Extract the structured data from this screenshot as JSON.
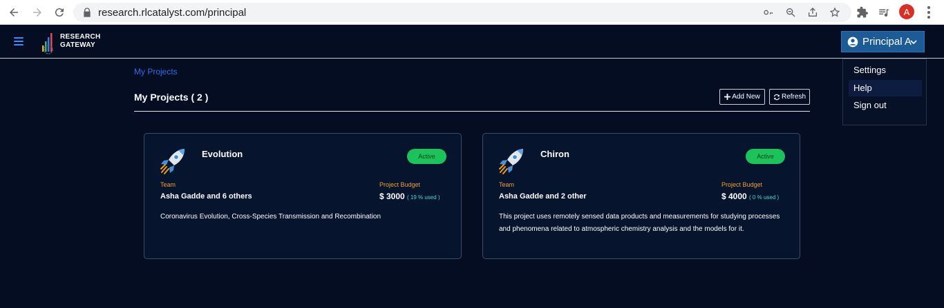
{
  "browser": {
    "url": "research.rlcatalyst.com/principal",
    "profile_initial": "A"
  },
  "header": {
    "logo_line1": "RESEARCH",
    "logo_line2": "GATEWAY",
    "user_label": "Principal A"
  },
  "user_menu": {
    "items": [
      {
        "label": "Settings"
      },
      {
        "label": "Help"
      },
      {
        "label": "Sign out"
      }
    ]
  },
  "breadcrumb": "My Projects",
  "page": {
    "title": "My Projects ( 2 )",
    "add_new_label": "Add New",
    "refresh_label": "Refresh"
  },
  "projects": [
    {
      "name": "Evolution",
      "status": "Active",
      "team_label": "Team",
      "team": "Asha Gadde and 6 others",
      "budget_label": "Project Budget",
      "budget": "$ 3000",
      "used": "( 19 % used )",
      "description": "Coronavirus Evolution, Cross-Species Transmission and Recombination"
    },
    {
      "name": "Chiron",
      "status": "Active",
      "team_label": "Team",
      "team": "Asha Gadde and 2 other",
      "budget_label": "Project Budget",
      "budget": "$ 4000",
      "used": "( 0 % used )",
      "description": "This project uses remotely sensed data products and measurements for studying processes and phenomena related to atmospheric chemistry analysis and the models for it."
    }
  ],
  "colors": {
    "background": "#040d22",
    "accent": "#1d5b97",
    "status_active": "#1cc35b",
    "label_orange": "#f0a030",
    "link_blue": "#2f6ee8"
  }
}
